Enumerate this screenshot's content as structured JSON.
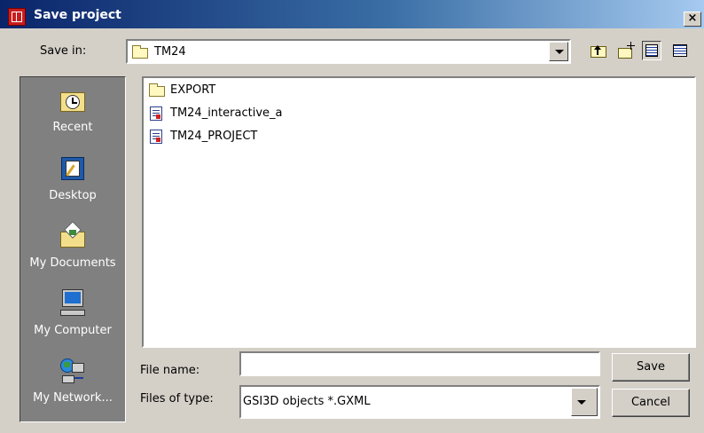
{
  "window": {
    "title": "Save project",
    "close_label": "×"
  },
  "toolbar": {
    "save_in_label": "Save in:",
    "save_in_value": "TM24",
    "icons": [
      "up-one-level-icon",
      "create-new-folder-icon",
      "list-view-icon",
      "details-view-icon"
    ]
  },
  "places": [
    {
      "label": "Recent",
      "icon": "recent-clock-icon"
    },
    {
      "label": "Desktop",
      "icon": "desktop-icon"
    },
    {
      "label": "My Documents",
      "icon": "my-documents-folder-icon"
    },
    {
      "label": "My Computer",
      "icon": "computer-monitor-icon"
    },
    {
      "label": "My Network...",
      "icon": "network-places-icon"
    }
  ],
  "files": [
    {
      "name": "EXPORT",
      "type": "folder"
    },
    {
      "name": "TM24_interactive_a",
      "type": "document"
    },
    {
      "name": "TM24_PROJECT",
      "type": "document"
    }
  ],
  "footer": {
    "file_name_label": "File name:",
    "file_name_value": "",
    "files_of_type_label": "Files of type:",
    "files_of_type_value": "GSI3D objects *.GXML",
    "save_label": "Save",
    "cancel_label": "Cancel"
  },
  "colors": {
    "title_gradient_start": "#0a246a",
    "title_gradient_end": "#a6caf0",
    "dialog_bg": "#d4d0c8",
    "places_bar": "#808080"
  }
}
